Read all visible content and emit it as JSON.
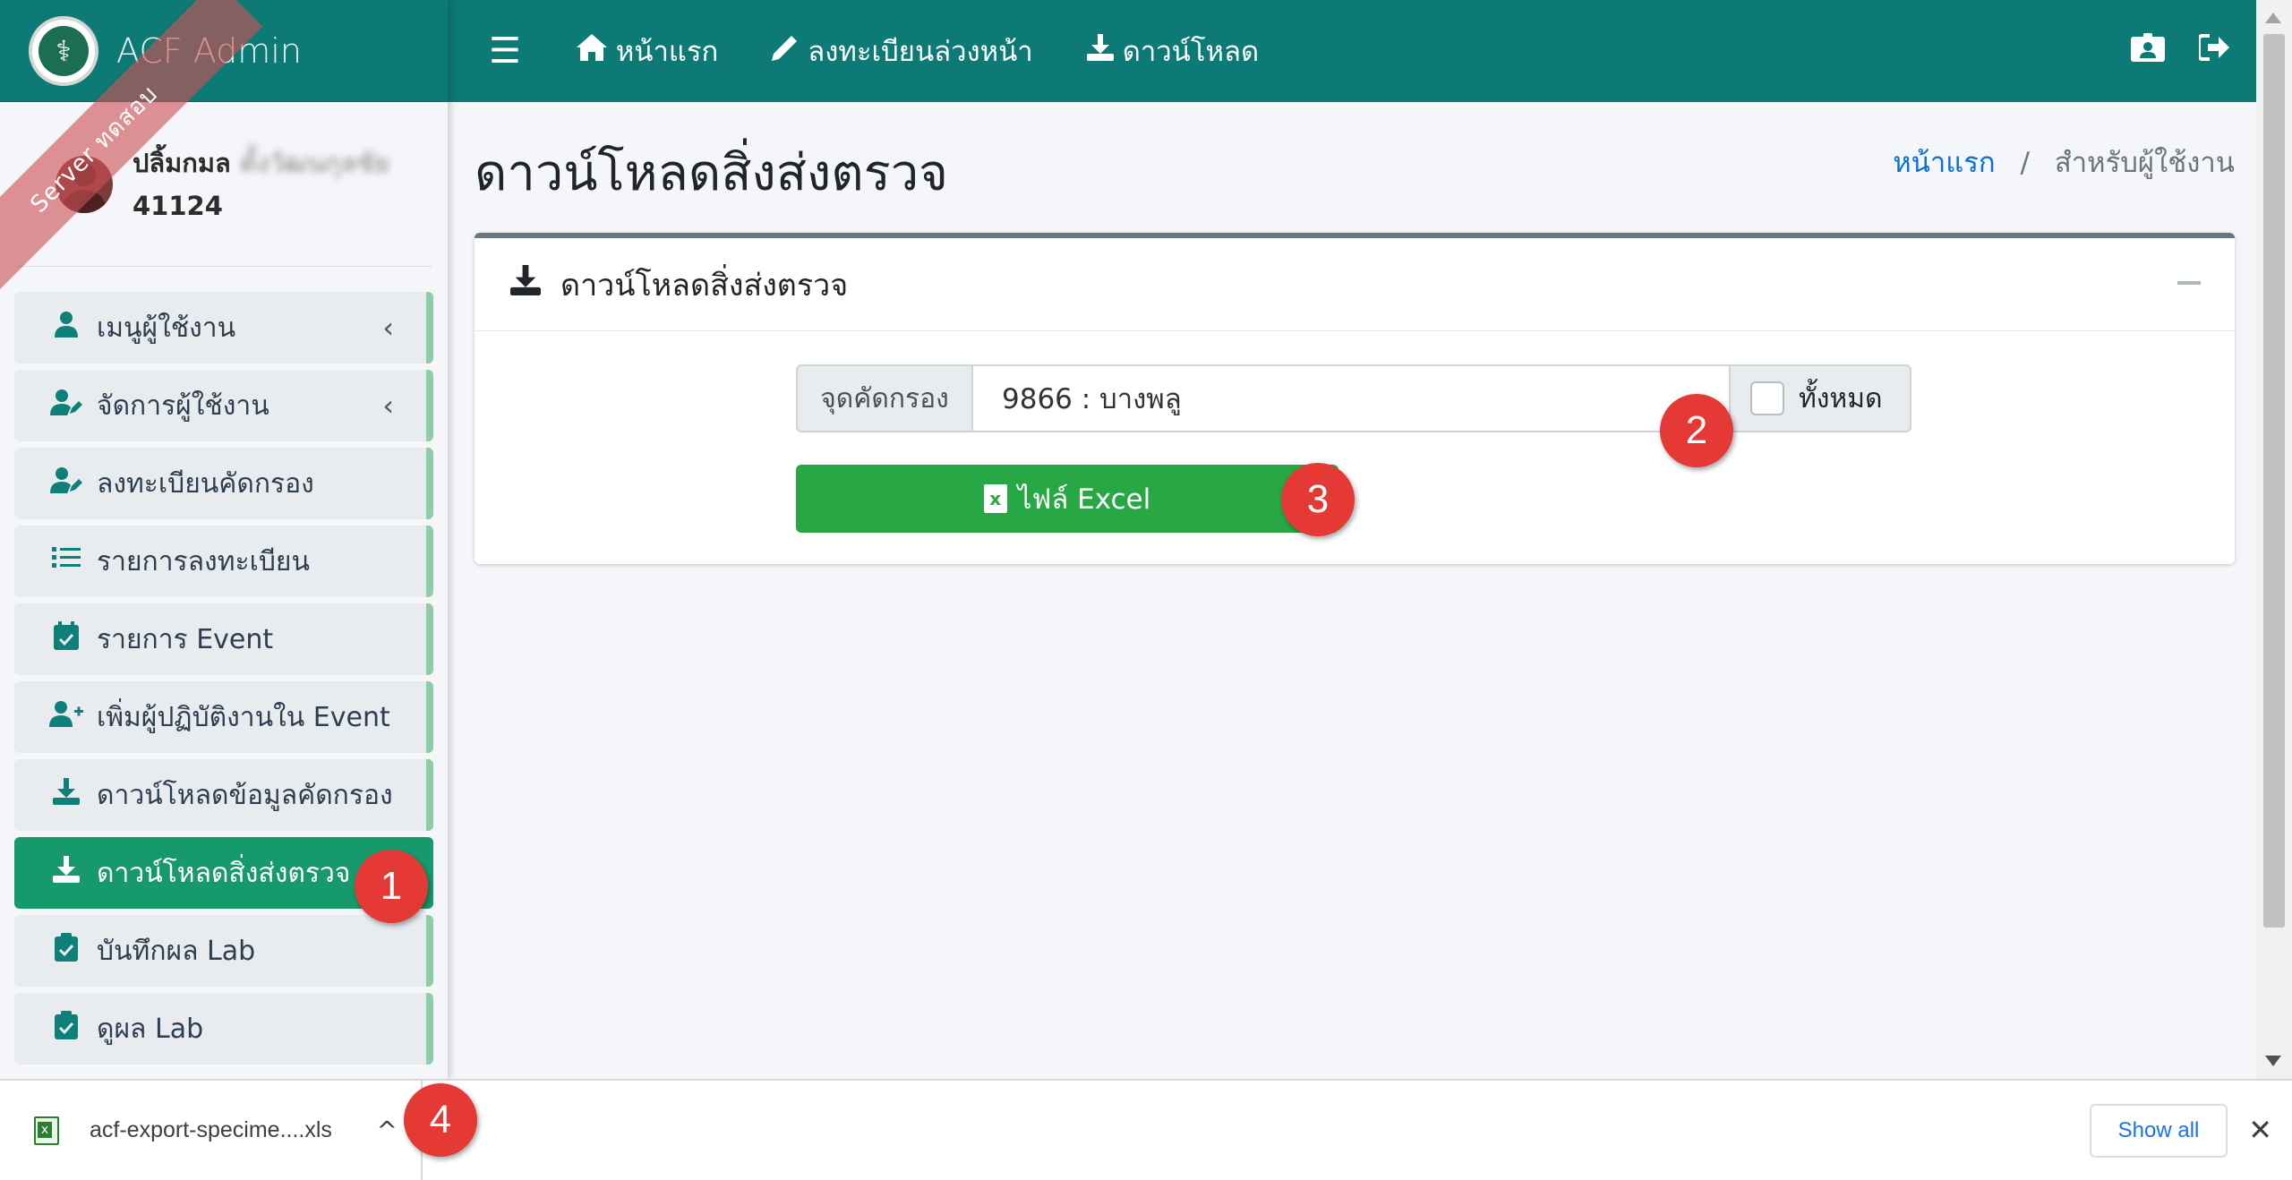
{
  "brand": {
    "title": "ACF Admin",
    "ribbon": "Server ทดสอบ"
  },
  "user": {
    "name": "ปลิ้มกมล",
    "name_suffix": "ตั้งวัฒนกุลชัย",
    "id": "41124"
  },
  "sidebar": {
    "items": [
      {
        "label": "เมนูผู้ใช้งาน",
        "icon": "user-icon",
        "has_chevron": true
      },
      {
        "label": "จัดการผู้ใช้งาน",
        "icon": "user-edit-icon",
        "has_chevron": true
      },
      {
        "label": "ลงทะเบียนคัดกรอง",
        "icon": "user-edit-icon"
      },
      {
        "label": "รายการลงทะเบียน",
        "icon": "list-icon"
      },
      {
        "label": "รายการ Event",
        "icon": "calendar-check-icon"
      },
      {
        "label": "เพิ่มผู้ปฏิบัติงานใน Event",
        "icon": "user-plus-icon"
      },
      {
        "label": "ดาวน์โหลดข้อมูลคัดกรอง",
        "icon": "download-icon"
      },
      {
        "label": "ดาวน์โหลดสิ่งส่งตรวจ",
        "icon": "download-icon",
        "active": true
      },
      {
        "label": "บันทึกผล Lab",
        "icon": "clipboard-check-icon"
      },
      {
        "label": "ดูผล Lab",
        "icon": "clipboard-check-icon"
      }
    ]
  },
  "navbar": {
    "items": [
      {
        "label": "หน้าแรก",
        "icon": "home-icon"
      },
      {
        "label": "ลงทะเบียนล่วงหน้า",
        "icon": "pencil-icon"
      },
      {
        "label": "ดาวน์โหลด",
        "icon": "download-icon"
      }
    ],
    "right_icons": [
      "id-card-icon",
      "sign-out-icon"
    ]
  },
  "page": {
    "title": "ดาวน์โหลดสิ่งส่งตรวจ",
    "breadcrumb": {
      "home": "หน้าแรก",
      "current": "สำหรับผู้ใช้งาน"
    }
  },
  "card": {
    "title": "ดาวน์โหลดสิ่งส่งตรวจ",
    "field_label": "จุดคัดกรอง",
    "selected_value": "9866 : บางพลู",
    "checkbox_label": "ทั้งหมด",
    "checkbox_checked": false,
    "excel_button": "ไฟล์ Excel"
  },
  "steps": [
    "1",
    "2",
    "3",
    "4"
  ],
  "download_bar": {
    "filename": "acf-export-specime....xls",
    "show_all": "Show all"
  },
  "colors": {
    "teal": "#0e7a75",
    "active_green": "#179a6b",
    "button_green": "#28a745",
    "badge_red": "#e53935",
    "link_blue": "#0a6fd6"
  }
}
